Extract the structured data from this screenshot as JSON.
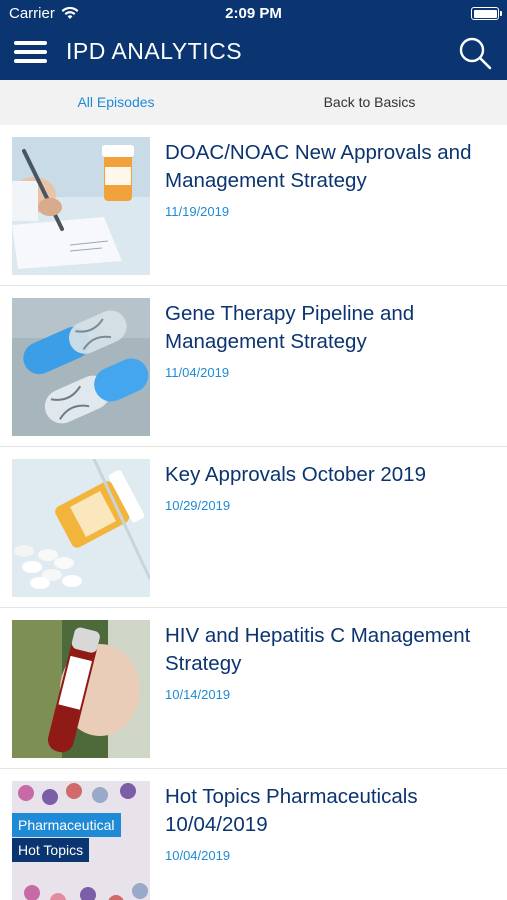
{
  "status_bar": {
    "carrier": "Carrier",
    "time": "2:09 PM"
  },
  "header": {
    "title": "IPD ANALYTICS",
    "menu_icon": "hamburger-menu-icon",
    "search_icon": "search-icon"
  },
  "tabs": [
    {
      "label": "All Episodes",
      "active": true
    },
    {
      "label": "Back to Basics",
      "active": false
    }
  ],
  "episodes": [
    {
      "title": "DOAC/NOAC New Approvals and Management Strategy",
      "date": "11/19/2019"
    },
    {
      "title": "Gene Therapy Pipeline and Management Strategy",
      "date": "11/04/2019"
    },
    {
      "title": "Key Approvals October 2019",
      "date": "10/29/2019"
    },
    {
      "title": "HIV and Hepatitis C Management Strategy",
      "date": "10/14/2019"
    },
    {
      "title": "Hot Topics Pharmaceuticals 10/04/2019",
      "date": "10/04/2019",
      "thumb_text": [
        "Pharmaceutical",
        "Hot Topics"
      ]
    }
  ],
  "colors": {
    "nav": "#0a3570",
    "accent": "#1f8ad6",
    "title": "#0b3470"
  }
}
